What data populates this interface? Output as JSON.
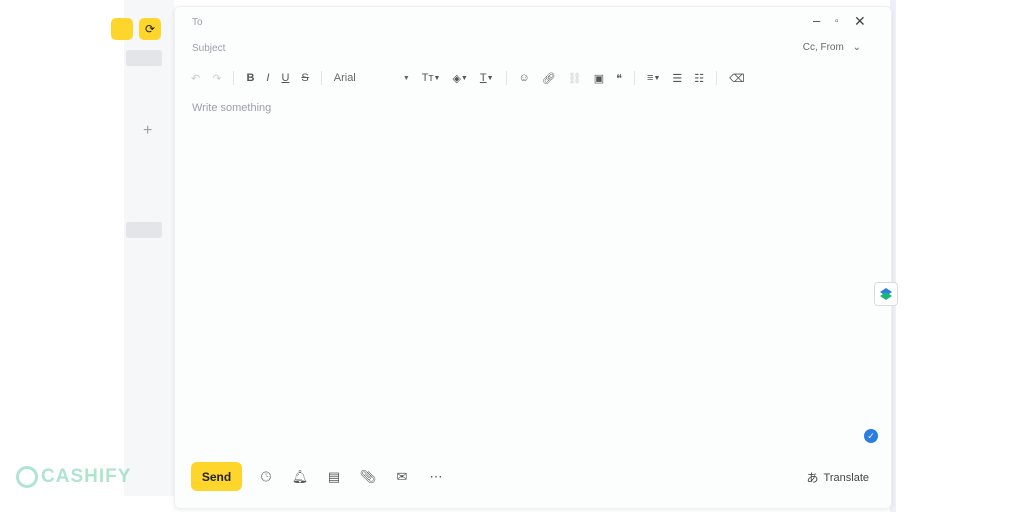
{
  "compose": {
    "to_label": "To",
    "subject_label": "Subject",
    "cc_from_label": "Cc, From",
    "body_placeholder": "Write something",
    "font_name": "Arial"
  },
  "toolbar": {
    "bold": "B",
    "italic": "I",
    "underline": "U",
    "strike": "S"
  },
  "actions": {
    "send_label": "Send",
    "translate_label": "Translate"
  },
  "watermark": {
    "text": "CASHIFY"
  },
  "colors": {
    "accent": "#fed52a",
    "check": "#2a7de1"
  }
}
